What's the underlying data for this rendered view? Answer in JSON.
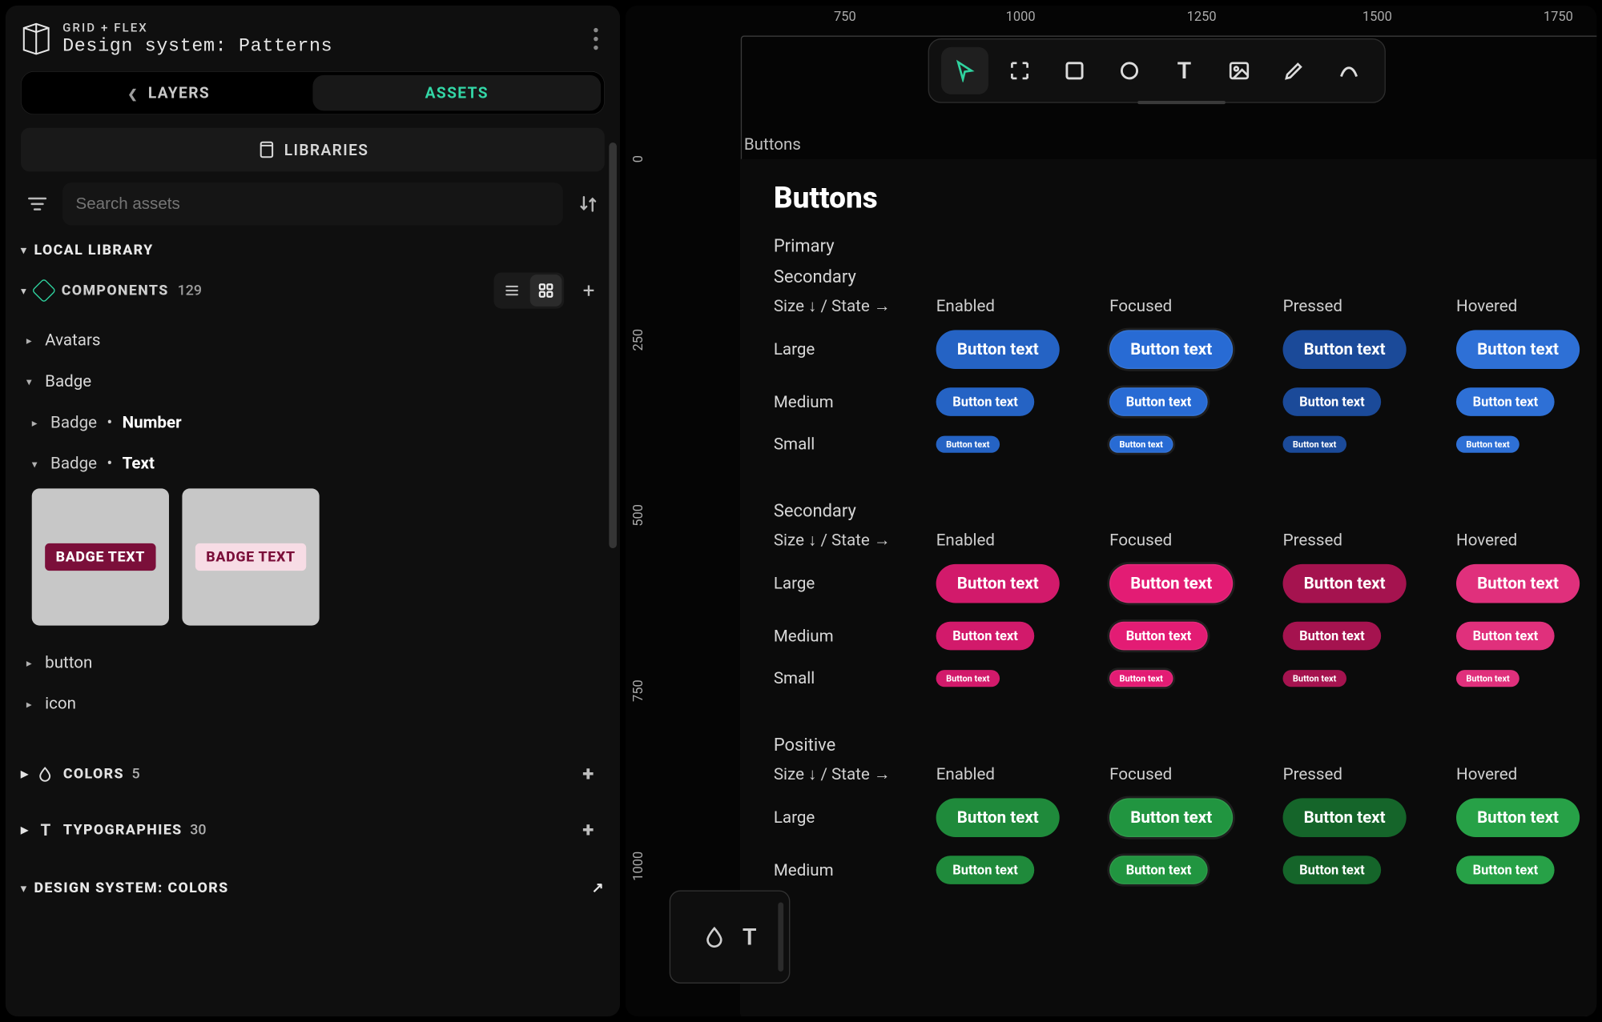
{
  "header": {
    "subtitle": "GRID + FLEX",
    "title": "Design system: Patterns"
  },
  "tabs": {
    "layers": "LAYERS",
    "assets": "ASSETS",
    "active": "assets"
  },
  "libraries_label": "LIBRARIES",
  "search": {
    "placeholder": "Search assets"
  },
  "sections": {
    "local_library": "LOCAL LIBRARY",
    "components": {
      "label": "COMPONENTS",
      "count": "129"
    },
    "colors": {
      "label": "COLORS",
      "count": "5"
    },
    "typographies": {
      "label": "TYPOGRAPHIES",
      "count": "30"
    },
    "design_system_colors": "DESIGN SYSTEM: COLORS"
  },
  "tree": {
    "avatars": "Avatars",
    "badge": "Badge",
    "badge_number": {
      "prefix": "Badge",
      "type": "Number"
    },
    "badge_text": {
      "prefix": "Badge",
      "type": "Text"
    },
    "button": "button",
    "icon": "icon"
  },
  "badge_cards": {
    "dark_text": "BADGE TEXT",
    "light_text": "BADGE TEXT"
  },
  "ruler_h": [
    "750",
    "1000",
    "1250",
    "1500",
    "1750"
  ],
  "ruler_v": [
    "0",
    "250",
    "500",
    "750",
    "1000"
  ],
  "frame_label": "Buttons",
  "doc": {
    "title": "Buttons",
    "groups": [
      {
        "title": "Primary",
        "subtitle": "Secondary",
        "color_class": "blue"
      },
      {
        "title": "Secondary",
        "color_class": "pink"
      },
      {
        "title": "Positive",
        "color_class": "green"
      }
    ],
    "size_state_label": "Size ↓ / State →",
    "states": [
      "Enabled",
      "Focused",
      "Pressed",
      "Hovered"
    ],
    "sizes": [
      "Large",
      "Medium",
      "Small"
    ],
    "button_text": "Button text"
  },
  "colors": {
    "accent": "#2fd39f",
    "primary_button": "#2563c4",
    "secondary_button": "#d21a6b",
    "positive_button": "#1f8a3b"
  }
}
